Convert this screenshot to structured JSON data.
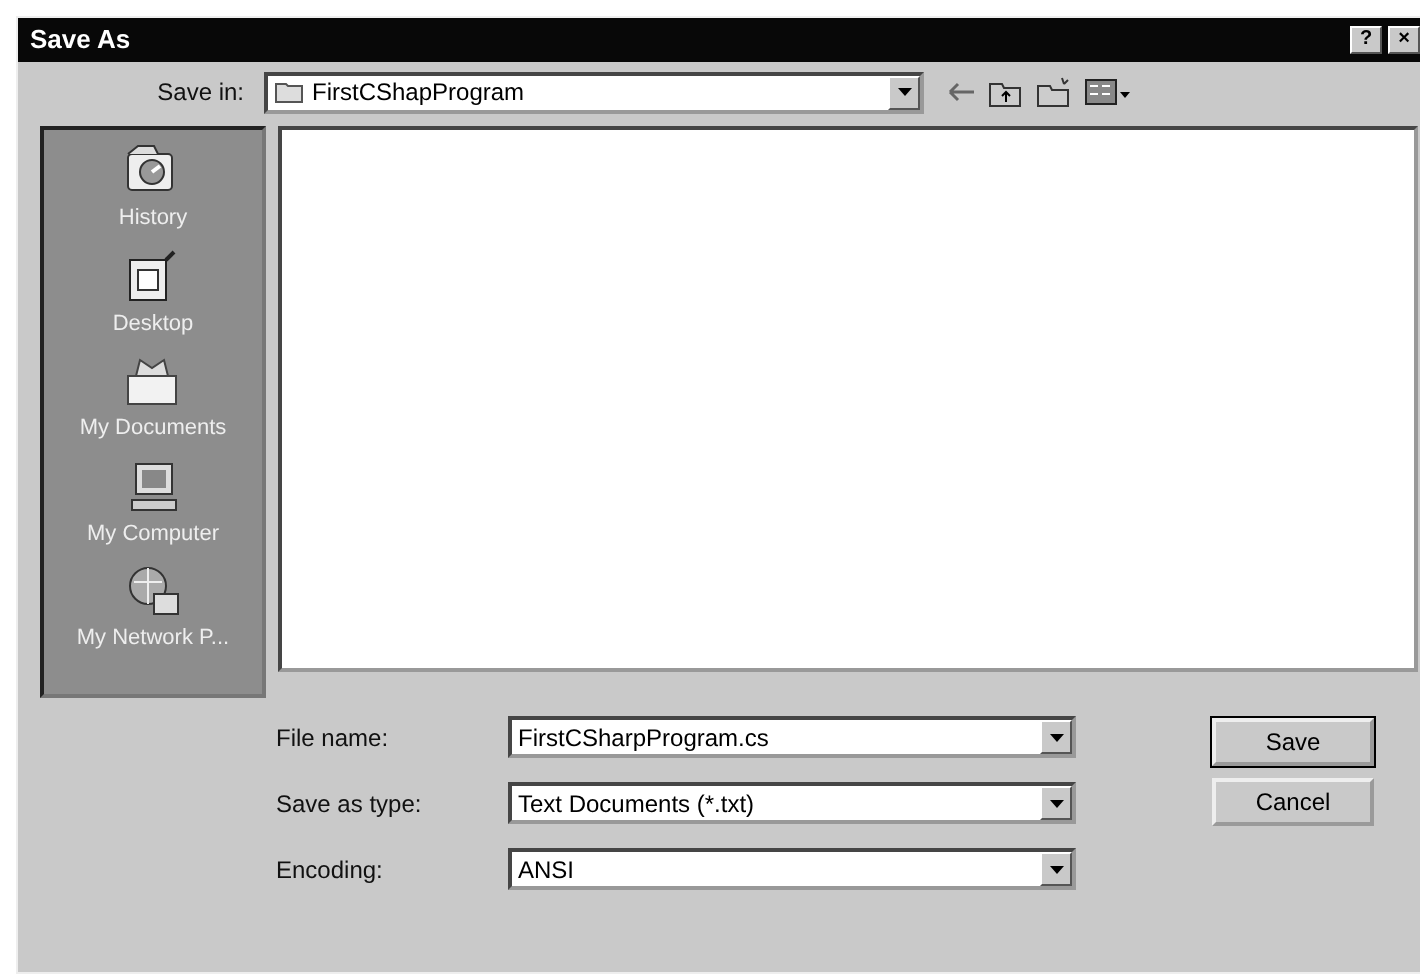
{
  "window": {
    "title": "Save As",
    "title_buttons": [
      "?",
      "×"
    ]
  },
  "save_in": {
    "label": "Save in:",
    "value": "FirstCShapProgram"
  },
  "places": [
    {
      "label": "History",
      "kind": "history"
    },
    {
      "label": "Desktop",
      "kind": "desktop"
    },
    {
      "label": "My Documents",
      "kind": "documents"
    },
    {
      "label": "My Computer",
      "kind": "computer"
    },
    {
      "label": "My Network P...",
      "kind": "network"
    }
  ],
  "fields": [
    {
      "label": "File name:",
      "value": "FirstCSharpProgram.cs"
    },
    {
      "label": "Save as type:",
      "value": "Text Documents (*.txt)"
    },
    {
      "label": "Encoding:",
      "value": "ANSI"
    }
  ],
  "buttons": [
    "Save",
    "Cancel"
  ]
}
